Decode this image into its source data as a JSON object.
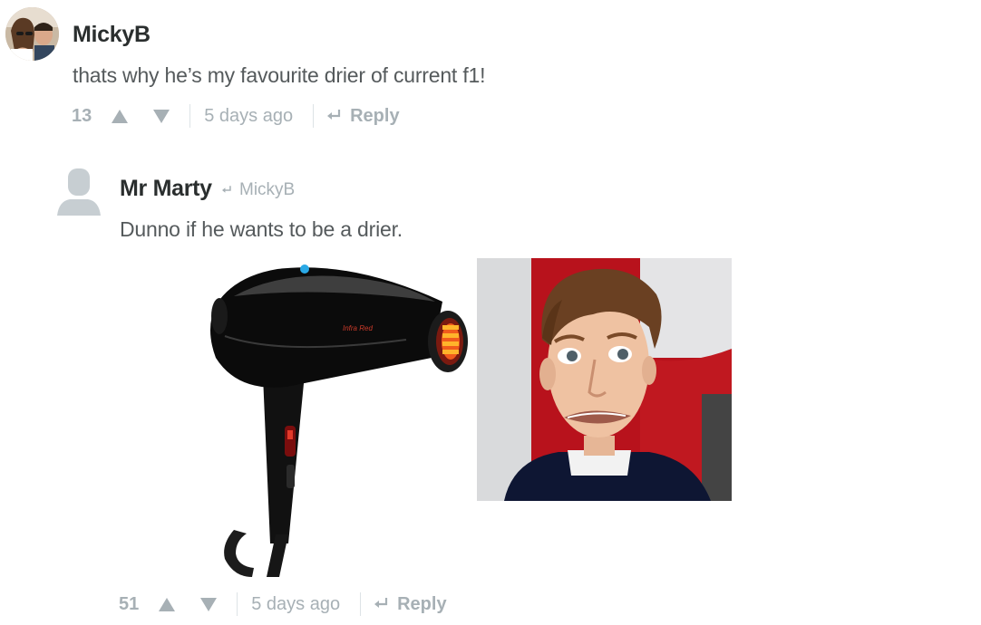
{
  "comments": [
    {
      "author": "MickyB",
      "text": "thats why he’s my favourite drier of current f1!",
      "votes": "13",
      "time": "5 days ago",
      "reply_label": "Reply"
    },
    {
      "author": "Mr Marty",
      "reply_to": "MickyB",
      "text": "Dunno if he wants to be a drier.",
      "votes": "51",
      "time": "5 days ago",
      "reply_label": "Reply",
      "hairdryer_brand_text": "Infra Red"
    }
  ],
  "colors": {
    "author": "#2a2e2e",
    "body_text": "#555a5c",
    "meta": "#a7b0b5",
    "separator": "#dde3e6"
  },
  "icons": [
    "upvote-icon",
    "downvote-icon",
    "reply-arrow-icon",
    "default-avatar-icon"
  ]
}
